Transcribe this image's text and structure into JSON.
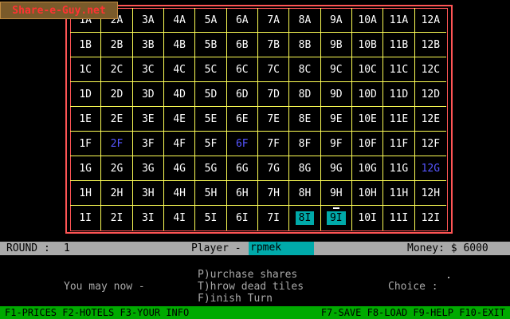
{
  "watermark": "Share-e-Guy.net",
  "board": {
    "cols": [
      "1",
      "2",
      "3",
      "4",
      "5",
      "6",
      "7",
      "8",
      "9",
      "10",
      "11",
      "12"
    ],
    "rows": [
      "A",
      "B",
      "C",
      "D",
      "E",
      "F",
      "G",
      "H",
      "I"
    ],
    "blue_tiles": [
      "2F",
      "6F",
      "12G"
    ],
    "placed_tiles": [
      "8I",
      "9I"
    ],
    "cursor_tile": "9I",
    "colors": {
      "grid": "#ffff55",
      "frame": "#ff5555",
      "tile_text": "#ffffff",
      "hotel_blue": "#5555ff",
      "placed_bg": "#00aaaa"
    }
  },
  "status": {
    "round_label": "ROUND :",
    "round_value": "1",
    "player_label": "Player -",
    "player_name": "rpmek",
    "money": "Money: $ 6000"
  },
  "prompt": {
    "you_may": "You may now -",
    "options": [
      "P)urchase shares",
      "T)hrow dead tiles",
      "F)inish Turn"
    ],
    "choice_label": "Choice :"
  },
  "fkeys": {
    "left": "F1-PRICES F2-HOTELS F3-YOUR INFO",
    "right": "F7-SAVE F8-LOAD F9-HELP F10-EXIT"
  }
}
